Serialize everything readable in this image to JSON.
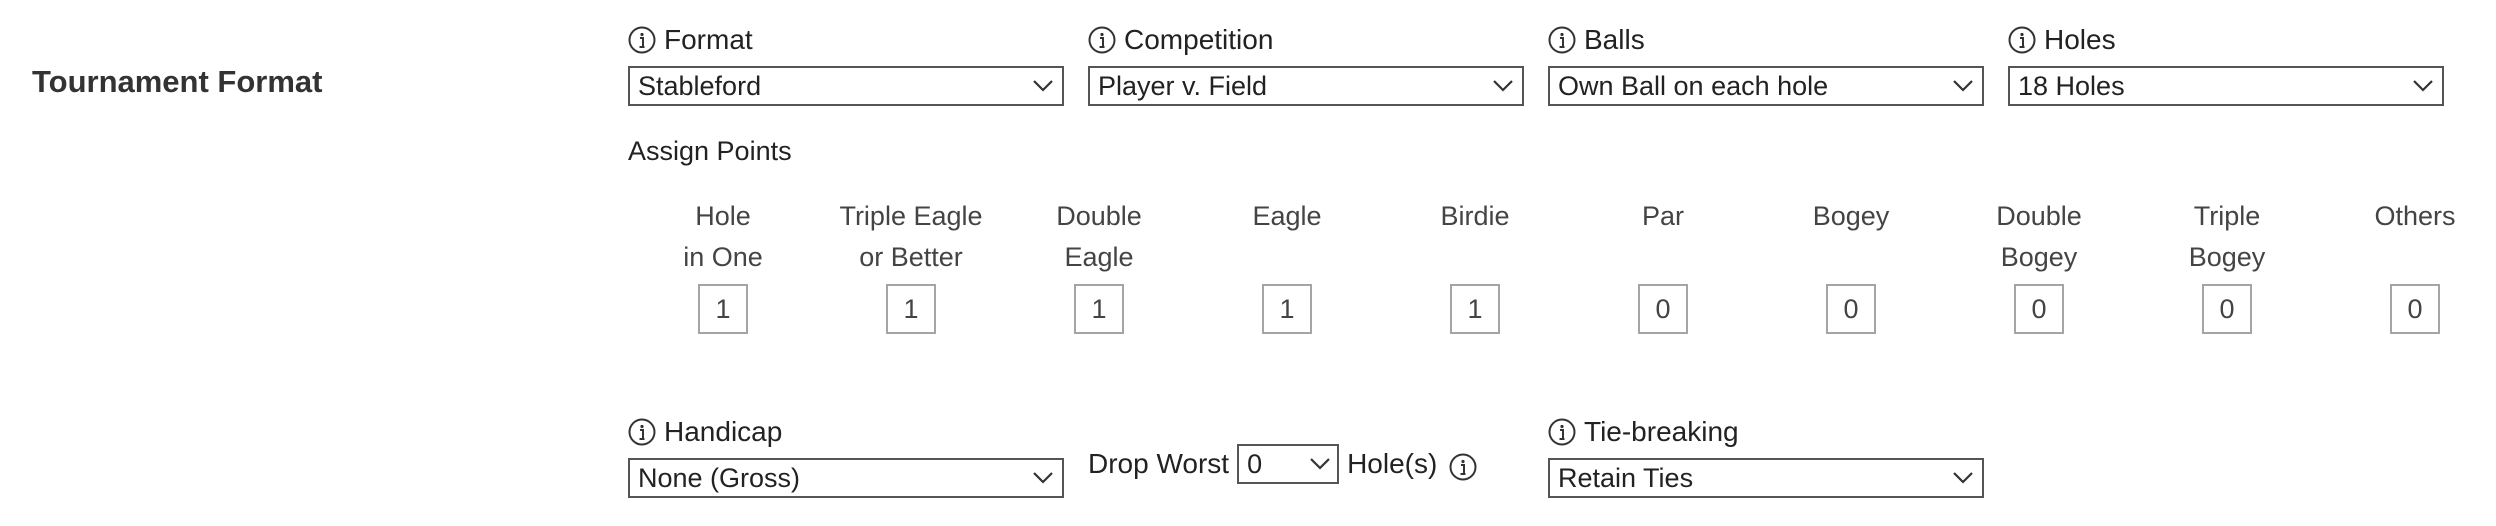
{
  "section": {
    "title": "Tournament Format"
  },
  "fields": {
    "format": {
      "label": "Format",
      "value": "Stableford"
    },
    "competition": {
      "label": "Competition",
      "value": "Player v. Field"
    },
    "balls": {
      "label": "Balls",
      "value": "Own Ball on each hole"
    },
    "holes": {
      "label": "Holes",
      "value": "18 Holes"
    },
    "handicap": {
      "label": "Handicap",
      "value": "None (Gross)"
    },
    "tie_breaking": {
      "label": "Tie-breaking",
      "value": "Retain Ties"
    }
  },
  "assign_points": {
    "label": "Assign Points",
    "columns": [
      {
        "line1": "Hole",
        "line2": "in One",
        "value": "1"
      },
      {
        "line1": "Triple Eagle",
        "line2": "or Better",
        "value": "1"
      },
      {
        "line1": "Double",
        "line2": "Eagle",
        "value": "1"
      },
      {
        "line1": "Eagle",
        "line2": "",
        "value": "1"
      },
      {
        "line1": "Birdie",
        "line2": "",
        "value": "1"
      },
      {
        "line1": "Par",
        "line2": "",
        "value": "0"
      },
      {
        "line1": "Bogey",
        "line2": "",
        "value": "0"
      },
      {
        "line1": "Double",
        "line2": "Bogey",
        "value": "0"
      },
      {
        "line1": "Triple",
        "line2": "Bogey",
        "value": "0"
      },
      {
        "line1": "Others",
        "line2": "",
        "value": "0"
      }
    ]
  },
  "drop_worst": {
    "prefix": "Drop Worst",
    "value": "0",
    "suffix": "Hole(s)"
  },
  "icons": {
    "info": "info-circle-icon",
    "chevron": "chevron-down-icon"
  },
  "colors": {
    "text": "#222222",
    "border": "#555555",
    "points_border": "#a5a5a5"
  }
}
